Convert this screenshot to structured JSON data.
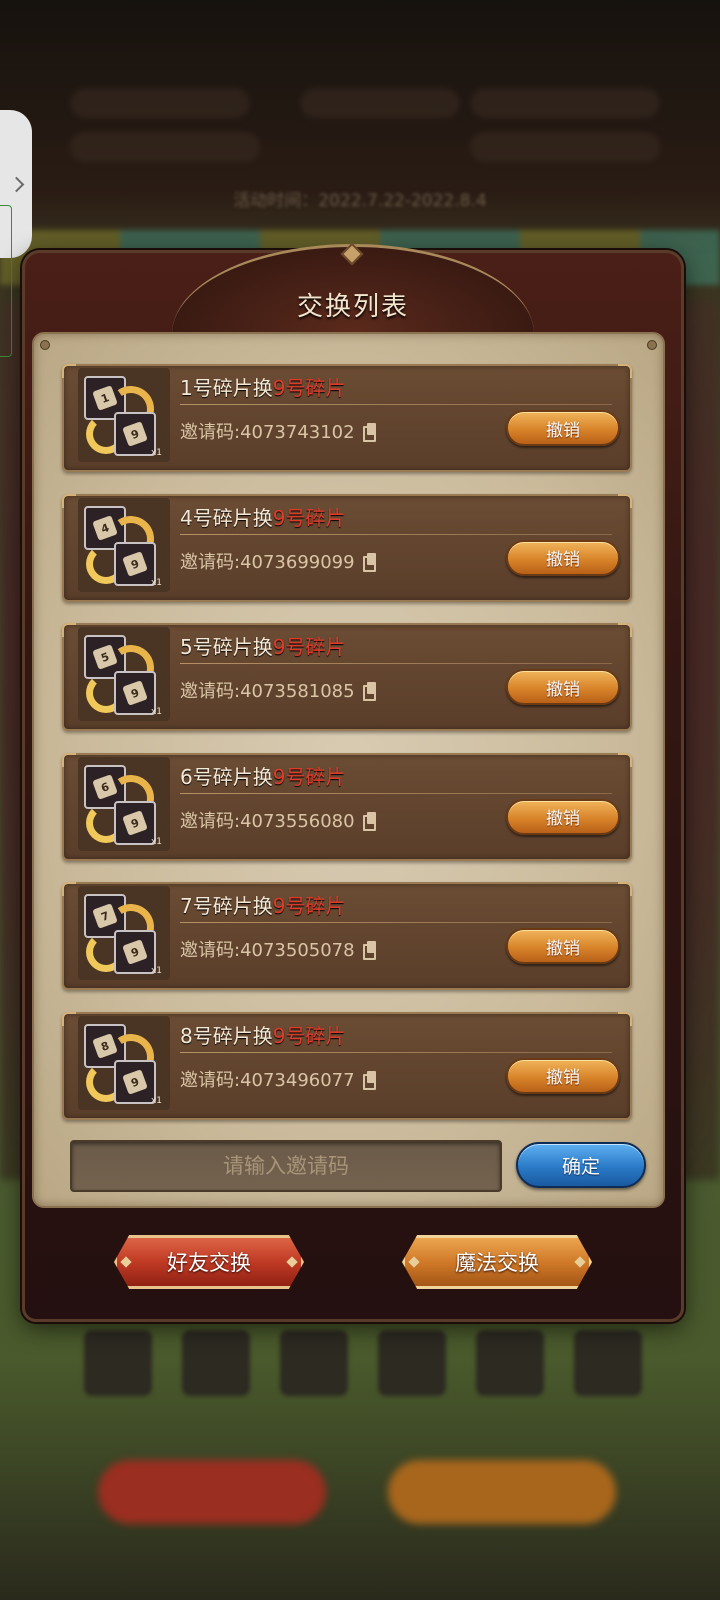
{
  "background": {
    "activity_time": "活动时间：2022.7.22-2022.8.4"
  },
  "dialog": {
    "title": "交换列表"
  },
  "trades": [
    {
      "from_num": "1",
      "title_prefix": "1号碎片换",
      "title_target": "9号碎片",
      "invite": "邀请码:4073743102",
      "revoke": "撤销",
      "to_num": "9",
      "qty": "x1"
    },
    {
      "from_num": "4",
      "title_prefix": "4号碎片换",
      "title_target": "9号碎片",
      "invite": "邀请码:4073699099",
      "revoke": "撤销",
      "to_num": "9",
      "qty": "x1"
    },
    {
      "from_num": "5",
      "title_prefix": "5号碎片换",
      "title_target": "9号碎片",
      "invite": "邀请码:4073581085",
      "revoke": "撤销",
      "to_num": "9",
      "qty": "x1"
    },
    {
      "from_num": "6",
      "title_prefix": "6号碎片换",
      "title_target": "9号碎片",
      "invite": "邀请码:4073556080",
      "revoke": "撤销",
      "to_num": "9",
      "qty": "x1"
    },
    {
      "from_num": "7",
      "title_prefix": "7号碎片换",
      "title_target": "9号碎片",
      "invite": "邀请码:4073505078",
      "revoke": "撤销",
      "to_num": "9",
      "qty": "x1"
    },
    {
      "from_num": "8",
      "title_prefix": "8号碎片换",
      "title_target": "9号碎片",
      "invite": "邀请码:4073496077",
      "revoke": "撤销",
      "to_num": "9",
      "qty": "x1"
    }
  ],
  "invite_input": {
    "placeholder": "请输入邀请码",
    "value": ""
  },
  "confirm_label": "确定",
  "tabs": {
    "friend": "好友交换",
    "magic": "魔法交换"
  },
  "colors": {
    "target_text": "#e03a2a",
    "revoke_button": "#d8842a",
    "confirm_button": "#2a7ac8",
    "friend_tab": "#c03a24",
    "magic_tab": "#d07a28"
  },
  "icons": [
    "copy-icon",
    "fragment-exchange-icon",
    "chevron-right-icon"
  ]
}
